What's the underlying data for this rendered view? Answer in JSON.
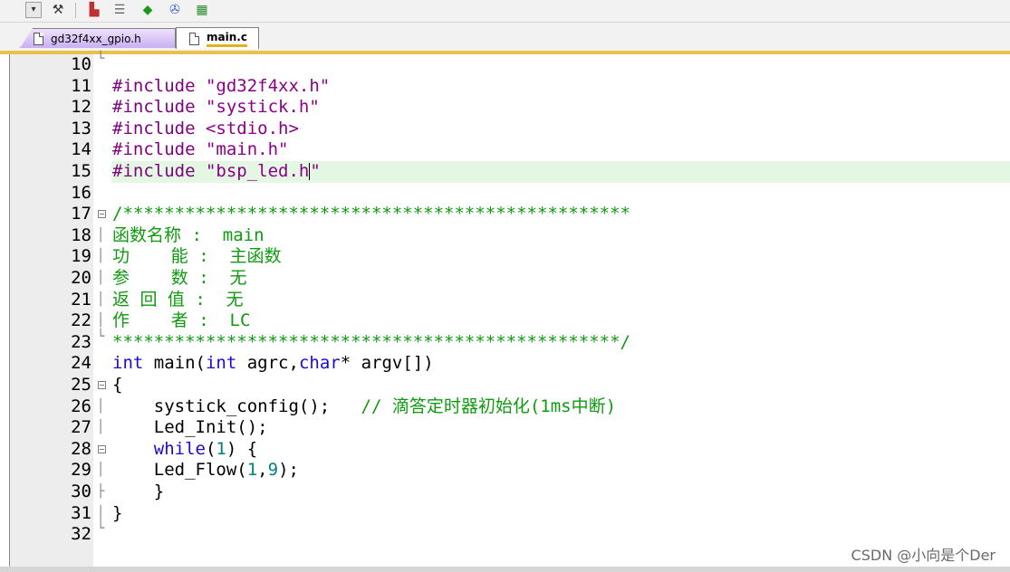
{
  "toolbar": {
    "icons": [
      "dropdown-icon",
      "wand-icon",
      "build-icon",
      "stack-icon",
      "diamond-icon",
      "wrench-icon",
      "books-icon"
    ]
  },
  "tabs": [
    {
      "label": "gd32f4xx_gpio.h",
      "active": false
    },
    {
      "label": "main.c",
      "active": true
    }
  ],
  "editor": {
    "lines": [
      {
        "n": "10"
      },
      {
        "n": "11",
        "text": "#include \"gd32f4xx.h\""
      },
      {
        "n": "12",
        "text": "#include \"systick.h\""
      },
      {
        "n": "13",
        "text": "#include <stdio.h>"
      },
      {
        "n": "14",
        "text": "#include \"main.h\""
      },
      {
        "n": "15",
        "text": "#include \"bsp_led.h\""
      },
      {
        "n": "16"
      },
      {
        "n": "17",
        "text": "/*************************************************"
      },
      {
        "n": "18",
        "text": "函数名称 :  main"
      },
      {
        "n": "19",
        "text": "功    能 :  主函数"
      },
      {
        "n": "20",
        "text": "参    数 :  无"
      },
      {
        "n": "21",
        "text": "返 回 值 :  无"
      },
      {
        "n": "22",
        "text": "作    者 :  LC"
      },
      {
        "n": "23",
        "text": "*************************************************/"
      },
      {
        "n": "24",
        "text": "int main(int agrc,char* argv[])"
      },
      {
        "n": "25",
        "text": "{"
      },
      {
        "n": "26",
        "text": "    systick_config();   // 滴答定时器初始化(1ms中断)"
      },
      {
        "n": "27",
        "text": "    Led_Init();"
      },
      {
        "n": "28",
        "text": "    while(1) {"
      },
      {
        "n": "29",
        "text": "    Led_Flow(1,9);"
      },
      {
        "n": "30",
        "text": "    }"
      },
      {
        "n": "31",
        "text": "}"
      },
      {
        "n": "32"
      }
    ],
    "code": {
      "l11a": "#include ",
      "l11b": "\"gd32f4xx.h\"",
      "l12a": "#include ",
      "l12b": "\"systick.h\"",
      "l13a": "#include ",
      "l13b": "<stdio.h>",
      "l14a": "#include ",
      "l14b": "\"main.h\"",
      "l15a": "#include ",
      "l15b": "\"bsp_led.h",
      "l15c": "\"",
      "l17": "/*************************************************",
      "l18": "函数名称 :  main",
      "l19": "功    能 :  主函数",
      "l20": "参    数 :  无",
      "l21": "返 回 值 :  无",
      "l22": "作    者 :  LC",
      "l23": "*************************************************/",
      "l24a": "int",
      "l24b": " main(",
      "l24c": "int",
      "l24d": " agrc,",
      "l24e": "char",
      "l24f": "* argv[])",
      "l25": "{",
      "l26a": "    systick_config();   ",
      "l26b": "// 滴答定时器初始化(1ms中断)",
      "l27": "    Led_Init();",
      "l28a": "    ",
      "l28b": "while",
      "l28c": "(",
      "l28d": "1",
      "l28e": ") {",
      "l29a": "    Led_Flow(",
      "l29b": "1",
      "l29c": ",",
      "l29d": "9",
      "l29e": ");",
      "l30": "    }",
      "l31": "}"
    }
  },
  "watermark": "CSDN @小向是个Der"
}
